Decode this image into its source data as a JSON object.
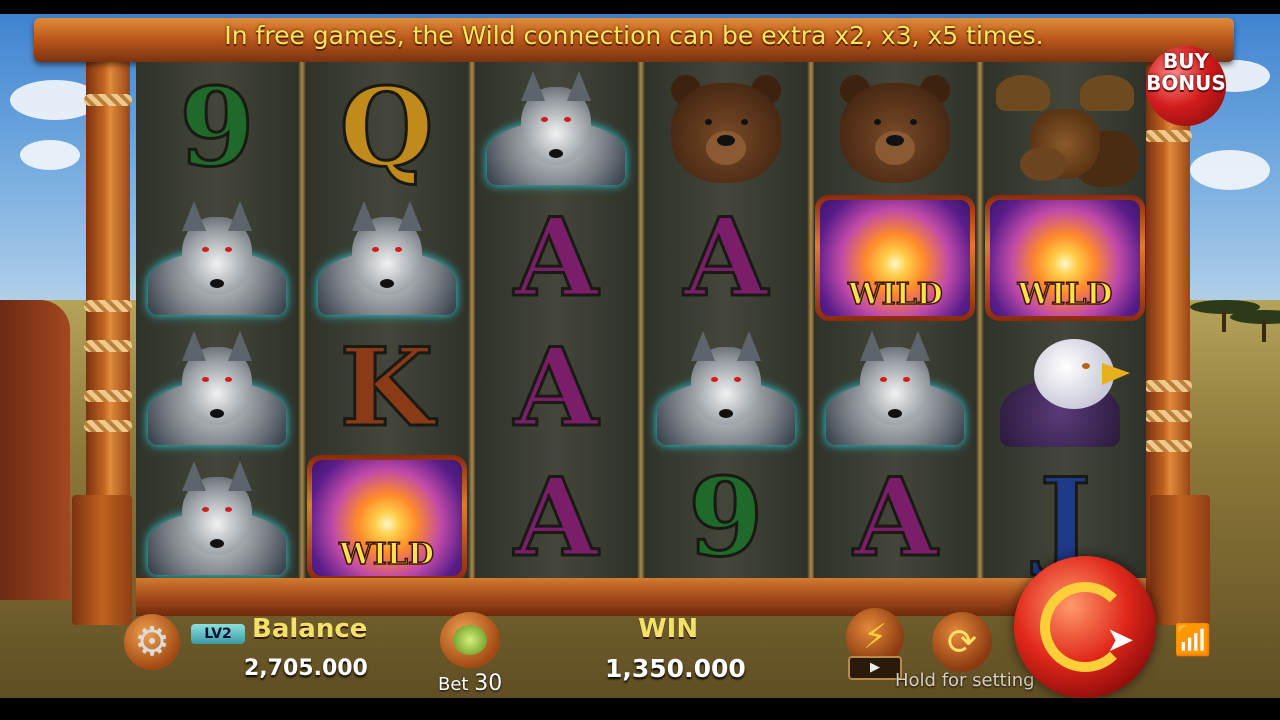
{
  "banner": {
    "text": "In free games, the Wild connection can be extra x2, x3, x5 times."
  },
  "buy_bonus": {
    "line1": "BUY",
    "line2": "BONUS"
  },
  "reels": [
    [
      "9",
      "wolf",
      "wolf",
      "wolf"
    ],
    [
      "Q",
      "wolf",
      "K",
      "wild"
    ],
    [
      "wolf",
      "A",
      "A",
      "A"
    ],
    [
      "bear",
      "A",
      "wolf",
      "9"
    ],
    [
      "bear",
      "wild",
      "wolf",
      "A"
    ],
    [
      "moose",
      "wild",
      "eagle",
      "J"
    ]
  ],
  "wild_label": "WILD",
  "bottom_bar": {
    "level_badge": "LV2",
    "balance_label": "Balance",
    "balance_value": "2,705.000",
    "bet_label": "Bet",
    "bet_value": "30",
    "win_label": "WIN",
    "win_value": "1,350.000",
    "hold_text": "Hold for setting"
  },
  "colors": {
    "banner_text": "#f8e65a",
    "label_gold": "#f2e26a",
    "wifi": "#3ad83a",
    "spin_button": "#e0281a"
  },
  "icons": {
    "settings": "gear-icon",
    "bet": "coin-stack-icon",
    "turbo": "lightning-icon",
    "auto": "autoplay-icon",
    "spin": "spin-icon",
    "signal": "wifi-icon"
  }
}
